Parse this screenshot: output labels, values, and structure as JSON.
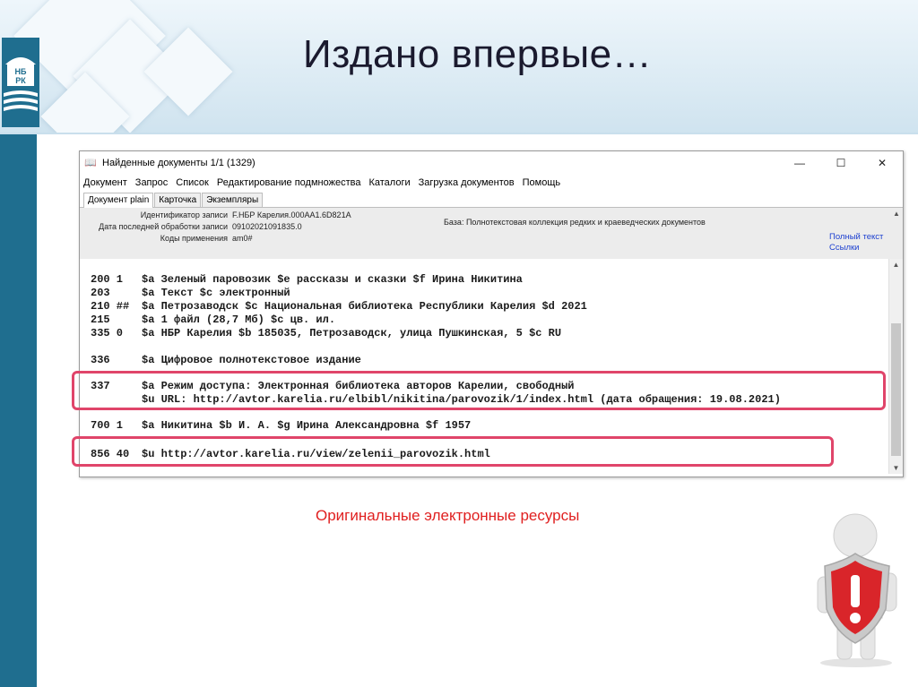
{
  "slide": {
    "title": "Издано впервые…",
    "caption": "Оригинальные электронные ресурсы",
    "logo_text_top": "НБ",
    "logo_text_bottom": "РК"
  },
  "window": {
    "title": "Найденные документы 1/1 (1329)",
    "controls": {
      "minimize": "—",
      "maximize": "☐",
      "close": "✕"
    },
    "menu": [
      "Документ",
      "Запрос",
      "Список",
      "Редактирование подмножества",
      "Каталоги",
      "Загрузка документов",
      "Помощь"
    ],
    "tabs": [
      "Документ plain",
      "Карточка",
      "Экземпляры"
    ],
    "info": {
      "id_label": "Идентификатор записи",
      "id_value": "F.НБР Карелия.000АА1.6D821A",
      "date_label": "Дата последней обработки записи",
      "date_value": "09102021091835.0",
      "codes_label": "Коды применения",
      "codes_value": "am0#",
      "db_text": "База: Полнотекстовая коллекция редких и краеведческих документов",
      "link_fulltext": "Полный текст",
      "link_links": "Ссылки"
    },
    "records": [
      {
        "tag": "200 1 ",
        "text": "$a Зеленый паровозик $e рассказы и сказки $f Ирина Никитина"
      },
      {
        "tag": "203   ",
        "text": "$a Текст $c электронный"
      },
      {
        "tag": "210 ##",
        "text": "$a Петрозаводск $c Национальная библиотека Республики Карелия $d 2021"
      },
      {
        "tag": "215   ",
        "text": "$a 1 файл (28,7 Мб) $c цв. ил."
      },
      {
        "tag": "335 0 ",
        "text": "$a НБР Карелия $b 185035, Петрозаводск, улица Пушкинская, 5 $c RU"
      },
      {
        "tag": "336   ",
        "text": "$a Цифровое полнотекстовое издание"
      },
      {
        "tag": "337   ",
        "text": "$a Режим доступа: Электронная библиотека авторов Карелии, свободный"
      },
      {
        "tag": "",
        "text": "$u URL: http://avtor.karelia.ru/elbibl/nikitina/parovozik/1/index.html (дата обращения: 19.08.2021)"
      },
      {
        "tag": "700 1 ",
        "text": "$a Никитина $b И. А. $g Ирина Александровна $f 1957"
      },
      {
        "tag": "856 40",
        "text": "$u http://avtor.karelia.ru/view/zelenii_parovozik.html"
      }
    ]
  },
  "colors": {
    "accent_stripe": "#1f6e8f",
    "highlight": "#e0456a",
    "caption": "#e02020",
    "link": "#1c3fd0"
  },
  "icons": [
    "book-icon",
    "minimize-icon",
    "maximize-icon",
    "close-icon",
    "scroll-up-icon",
    "scroll-down-icon",
    "warning-shield-icon"
  ]
}
